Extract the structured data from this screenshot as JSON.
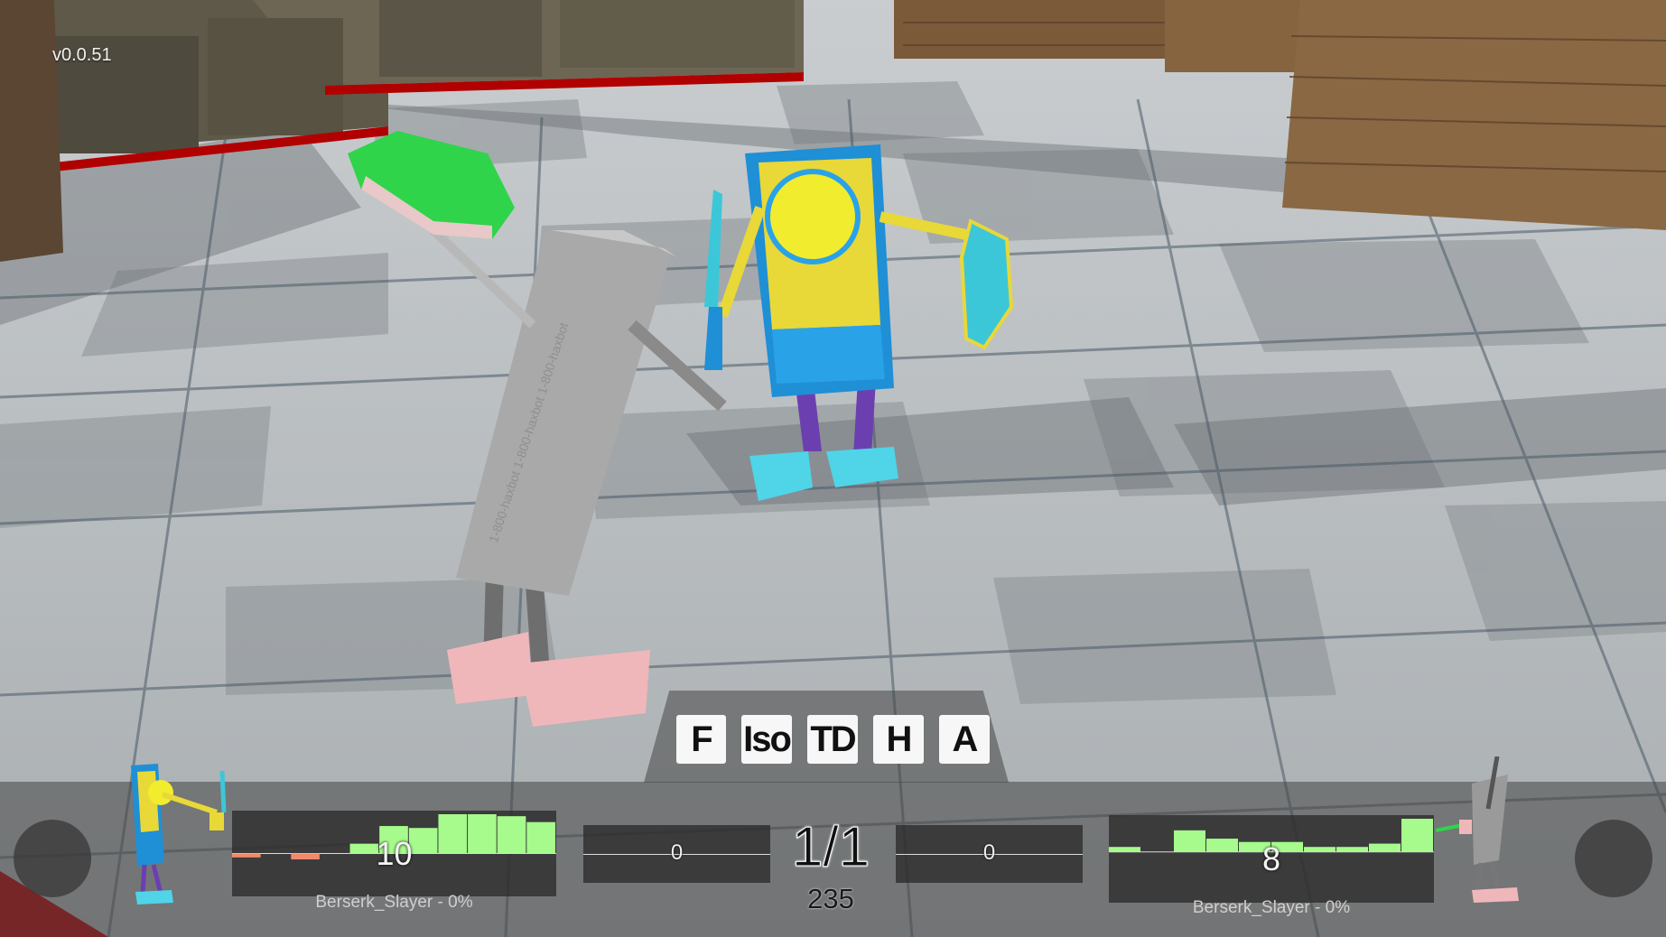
{
  "version": "v0.0.51",
  "camera_buttons": [
    "F",
    "Iso",
    "TD",
    "H",
    "A"
  ],
  "left_player": {
    "name_label": "Berserk_Slayer - 0%",
    "graph_value": "10",
    "side_value": "0",
    "graph_bars": [
      -0.1,
      0,
      -0.15,
      0,
      0.25,
      0.7,
      0.65,
      1.0,
      1.0,
      0.95,
      0.8
    ],
    "bar_color": "#a6fb8c",
    "neg_color": "#f08a6a"
  },
  "right_player": {
    "name_label": "Berserk_Slayer - 0%",
    "graph_value": "8",
    "side_value": "0",
    "graph_bars": [
      0.15,
      0,
      0.65,
      0.4,
      0.3,
      0.3,
      0.15,
      0.15,
      0.25,
      1.0
    ],
    "bar_color": "#a6fb8c"
  },
  "match": {
    "score": "1/1",
    "timer": "235"
  }
}
